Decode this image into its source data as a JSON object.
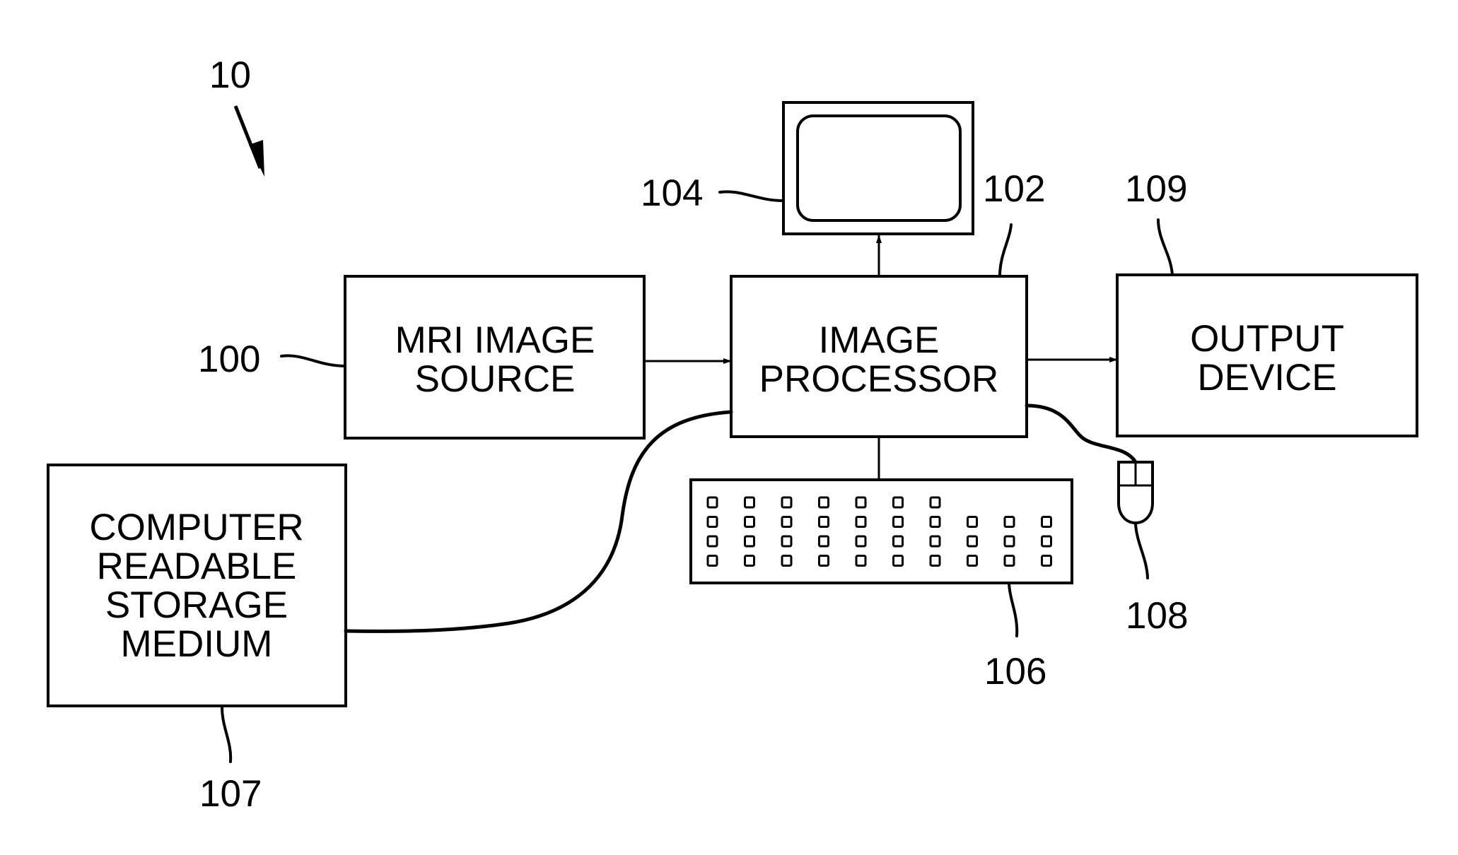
{
  "figure": {
    "system_ref": "10",
    "components": {
      "mri_image_source": {
        "ref": "100",
        "lines": [
          "MRI IMAGE",
          "SOURCE"
        ]
      },
      "image_processor": {
        "ref": "102",
        "lines": [
          "IMAGE",
          "PROCESSOR"
        ]
      },
      "display_monitor": {
        "ref": "104"
      },
      "keyboard": {
        "ref": "106",
        "rows": [
          7,
          10,
          10,
          10
        ]
      },
      "storage_medium": {
        "ref": "107",
        "lines": [
          "COMPUTER",
          "READABLE",
          "STORAGE",
          "MEDIUM"
        ]
      },
      "mouse": {
        "ref": "108"
      },
      "output_device": {
        "ref": "109",
        "lines": [
          "OUTPUT",
          "DEVICE"
        ]
      }
    },
    "connections": [
      {
        "from": "mri_image_source",
        "to": "image_processor",
        "arrow": true
      },
      {
        "from": "image_processor",
        "to": "display_monitor",
        "arrow": true
      },
      {
        "from": "image_processor",
        "to": "output_device",
        "arrow": true
      },
      {
        "from": "image_processor",
        "to": "keyboard",
        "arrow": false
      },
      {
        "from": "image_processor",
        "to": "mouse",
        "arrow": false
      },
      {
        "from": "storage_medium",
        "to": "image_processor",
        "arrow": false
      }
    ]
  }
}
